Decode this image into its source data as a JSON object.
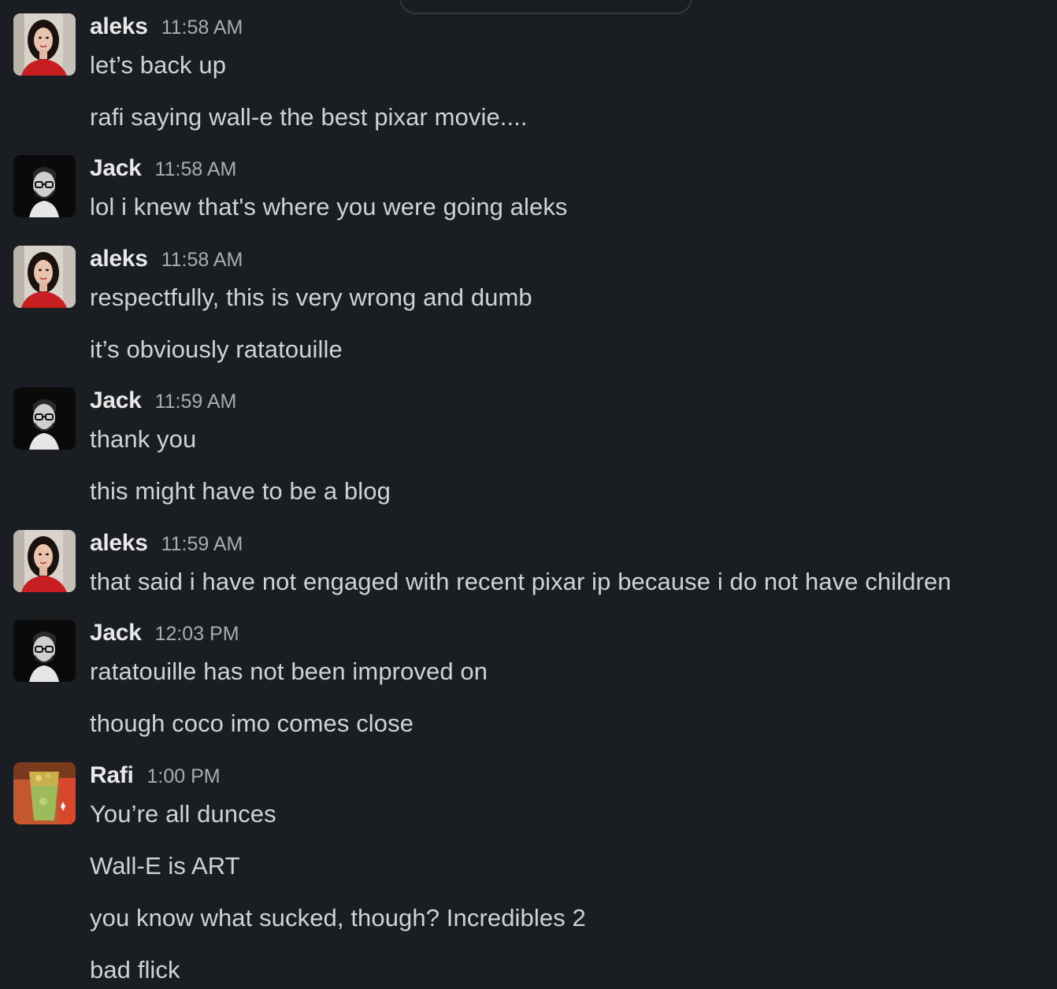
{
  "users": {
    "aleks": {
      "name": "aleks",
      "avatar_icon": "woman-portrait-avatar"
    },
    "jack": {
      "name": "Jack",
      "avatar_icon": "man-glasses-avatar"
    },
    "rafi": {
      "name": "Rafi",
      "avatar_icon": "cocktail-drink-avatar"
    }
  },
  "messages": [
    {
      "user": "aleks",
      "time": "11:58 AM",
      "lines": [
        "let’s back up",
        "rafi saying wall-e the best pixar movie...."
      ]
    },
    {
      "user": "Jack",
      "time": "11:58 AM",
      "lines": [
        "lol i knew that's where you were going aleks"
      ]
    },
    {
      "user": "aleks",
      "time": "11:58 AM",
      "lines": [
        "respectfully, this is very wrong and dumb",
        "it’s obviously ratatouille"
      ]
    },
    {
      "user": "Jack",
      "time": "11:59 AM",
      "lines": [
        "thank you",
        "this might have to be a blog"
      ]
    },
    {
      "user": "aleks",
      "time": "11:59 AM",
      "lines": [
        "that said i have not engaged with recent pixar ip because i do not have children"
      ]
    },
    {
      "user": "Jack",
      "time": "12:03 PM",
      "lines": [
        "ratatouille has not been improved on",
        "though coco imo comes close"
      ]
    },
    {
      "user": "Rafi",
      "time": "1:00 PM",
      "lines": [
        "You’re all dunces",
        "Wall-E is ART",
        "you know what sucked, though? Incredibles 2",
        "bad flick"
      ]
    }
  ],
  "colors": {
    "background": "#1a1d21",
    "text": "#d1d2d3",
    "username": "#e8e8e8",
    "timestamp": "#abacae"
  }
}
